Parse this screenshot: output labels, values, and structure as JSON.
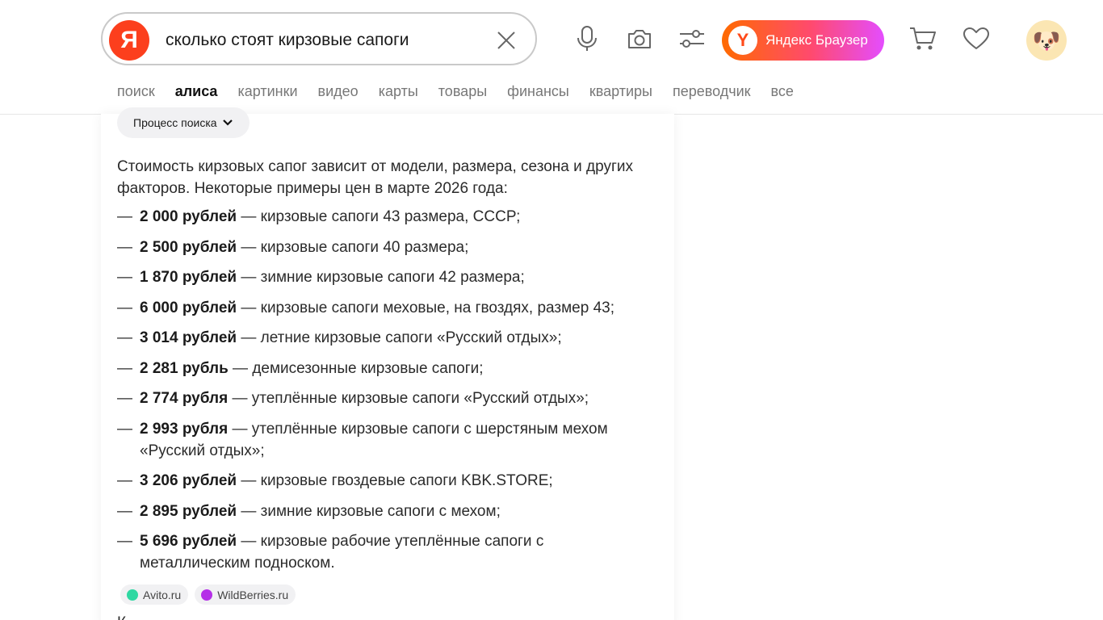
{
  "search": {
    "logo_letter": "Я",
    "query": "сколько стоят кирзовые сапоги",
    "clear_icon": "close-icon"
  },
  "header_icons": [
    "microphone-icon",
    "camera-icon",
    "filters-icon",
    "cart-icon",
    "heart-icon"
  ],
  "browser_button": {
    "label": "Яндекс Браузер",
    "logo_letter": "Y"
  },
  "avatar": {
    "emoji": "🐶"
  },
  "tabs": [
    {
      "label": "поиск",
      "active": false
    },
    {
      "label": "алиса",
      "active": true
    },
    {
      "label": "картинки",
      "active": false
    },
    {
      "label": "видео",
      "active": false
    },
    {
      "label": "карты",
      "active": false
    },
    {
      "label": "товары",
      "active": false
    },
    {
      "label": "финансы",
      "active": false
    },
    {
      "label": "квартиры",
      "active": false
    },
    {
      "label": "переводчик",
      "active": false
    },
    {
      "label": "все",
      "active": false
    }
  ],
  "answer": {
    "process_label": "Процесс поиска",
    "intro": "Стоимость кирзовых сапог зависит от модели, размера, сезона и других факторов. Некоторые примеры цен в марте 2026 года:",
    "items": [
      {
        "price": "2 000 рублей",
        "text": " — кирзовые сапоги 43 размера, СССР;"
      },
      {
        "price": "2 500 рублей",
        "text": " — кирзовые сапоги 40 размера;"
      },
      {
        "price": "1 870 рублей",
        "text": " — зимние кирзовые сапоги 42 размера;"
      },
      {
        "price": "6 000 рублей",
        "text": " — кирзовые сапоги меховые, на гвоздях, размер 43;"
      },
      {
        "price": "3 014 рублей",
        "text": " — летние кирзовые сапоги «Русский отдых»;"
      },
      {
        "price": "2 281 рубль",
        "text": " — демисезонные кирзовые сапоги;"
      },
      {
        "price": "2 774 рубля",
        "text": " — утеплённые кирзовые сапоги «Русский отдых»;"
      },
      {
        "price": "2 993 рубля",
        "text": " — утеплённые кирзовые сапоги с шерстяным мехом «Русский отдых»;"
      },
      {
        "price": "3 206 рублей",
        "text": " — кирзовые гвоздевые сапоги KBK.STORE;"
      },
      {
        "price": "2 895 рублей",
        "text": " — зимние кирзовые сапоги с мехом;"
      },
      {
        "price": "5 696 рублей",
        "text": " — кирзовые рабочие утеплённые сапоги с металлическим подноском."
      }
    ],
    "dash": "—",
    "sources": [
      {
        "label": "Avito.ru",
        "color": "#2fd8a2"
      },
      {
        "label": "WildBerries.ru",
        "color": "#b52fe8"
      }
    ],
    "truncated_line": "К"
  }
}
